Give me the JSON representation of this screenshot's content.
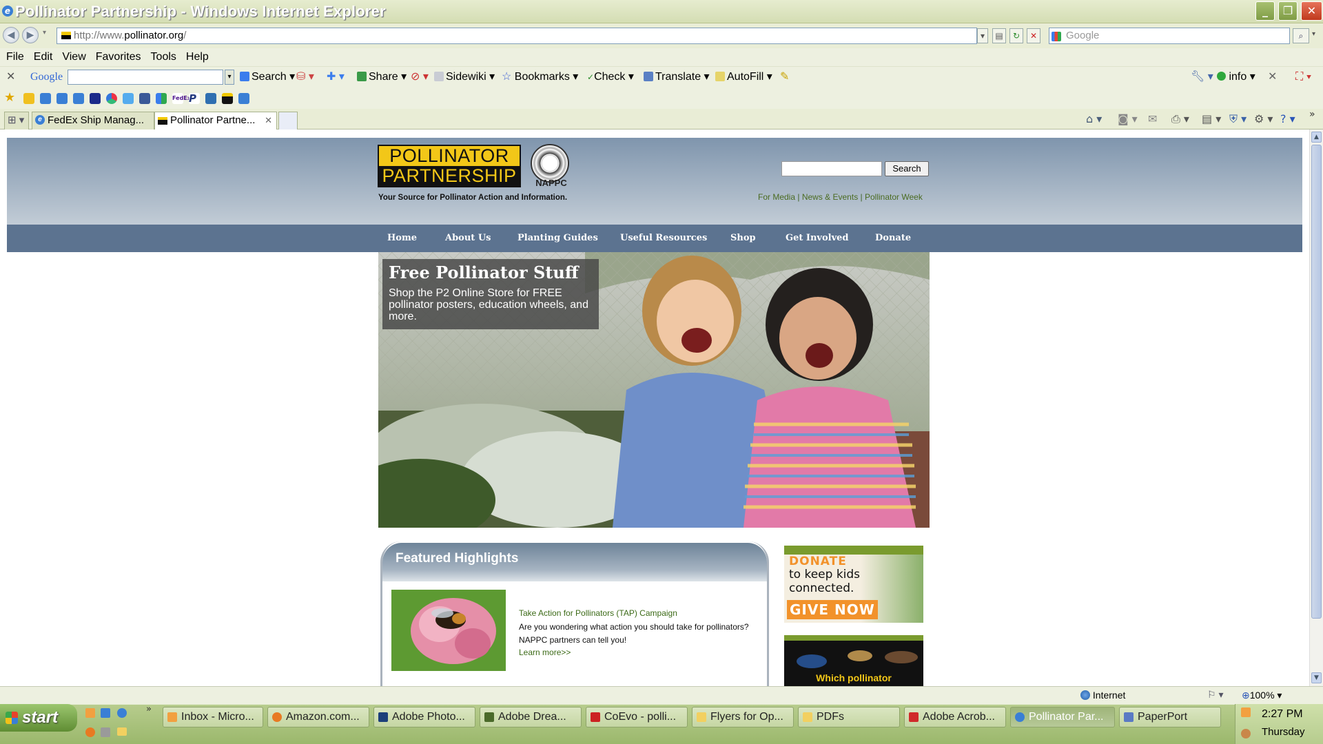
{
  "window": {
    "title": "Pollinator Partnership - Windows Internet Explorer"
  },
  "address": {
    "prefix": "http://www.",
    "host": "pollinator.org",
    "suffix": "/",
    "search_placeholder": "Google"
  },
  "menu": [
    "File",
    "Edit",
    "View",
    "Favorites",
    "Tools",
    "Help"
  ],
  "google_toolbar": {
    "brand": "Google",
    "items": [
      "Search",
      "Share",
      "Sidewiki",
      "Bookmarks",
      "Check",
      "Translate",
      "AutoFill",
      "info"
    ]
  },
  "tabs": [
    {
      "label": "FedEx Ship Manag..."
    },
    {
      "label": "Pollinator Partne..."
    }
  ],
  "site": {
    "logo_line1": "POLLINATOR",
    "logo_line2": "PARTNERSHIP",
    "logo_badge": "NAPPC",
    "tagline": "Your Source for Pollinator Action and Information.",
    "search_button": "Search",
    "top_links": [
      "For Media",
      "News & Events",
      "Pollinator Week"
    ],
    "nav": [
      "Home",
      "About Us",
      "Planting Guides",
      "Useful Resources",
      "Shop",
      "Get Involved",
      "Donate"
    ],
    "hero": {
      "title": "Free Pollinator Stuff",
      "text": "Shop the P2 Online Store for FREE pollinator posters, education wheels, and more."
    },
    "featured": {
      "heading": "Featured Highlights",
      "item_title": "Take Action for Pollinators (TAP) Campaign",
      "item_text": "Are you wondering what action you should take for pollinators? NAPPC partners can tell you!",
      "item_more": "Learn more>>"
    },
    "ad_donate": {
      "line1": "DONATE",
      "line2": "to keep kids connected.",
      "cta": "GIVE NOW"
    },
    "ad_pollinator": {
      "text": "Which pollinator"
    }
  },
  "status": {
    "zone": "Internet",
    "zoom": "100%"
  },
  "taskbar": {
    "start": "start",
    "tasks": [
      "Inbox - Micro...",
      "Amazon.com...",
      "Adobe Photo...",
      "Adobe Drea...",
      "CoEvo - polli...",
      "Flyers for Op...",
      "PDFs",
      "Adobe Acrob...",
      "Pollinator Par...",
      "PaperPort"
    ],
    "time": "2:27 PM",
    "day": "Thursday"
  }
}
